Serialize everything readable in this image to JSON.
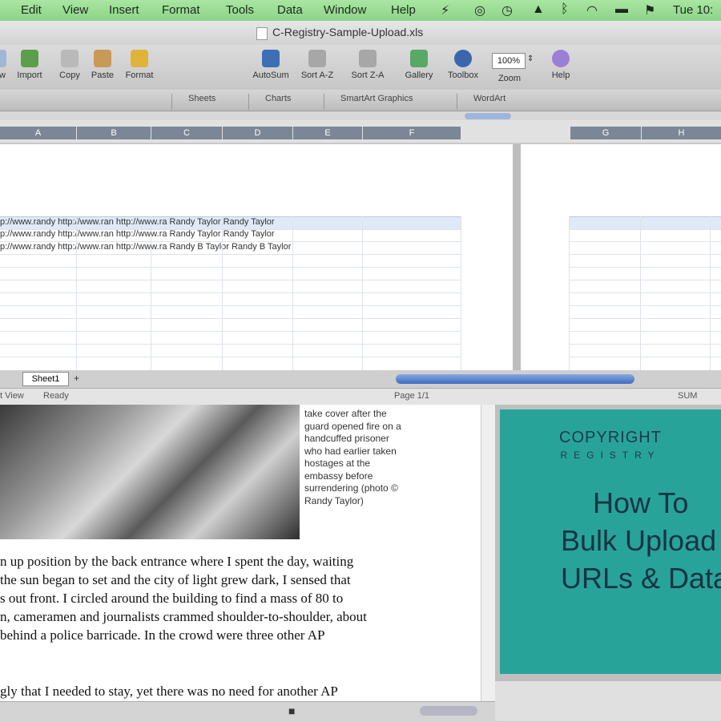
{
  "menubar": {
    "items": [
      "Edit",
      "View",
      "Insert",
      "Format",
      "Tools",
      "Data",
      "Window",
      "Help"
    ],
    "clock": "Tue 10:"
  },
  "window": {
    "title": "C-Registry-Sample-Upload.xls"
  },
  "toolbar": {
    "items": [
      "Import",
      "Copy",
      "Paste",
      "Format",
      "AutoSum",
      "Sort A-Z",
      "Sort Z-A",
      "Gallery",
      "Toolbox",
      "Zoom",
      "Help"
    ],
    "new_label": "w",
    "zoom_value": "100%"
  },
  "ribbon": {
    "tabs": [
      "Sheets",
      "Charts",
      "SmartArt Graphics",
      "WordArt"
    ]
  },
  "columns": {
    "left": [
      "A",
      "B",
      "C",
      "D",
      "E",
      "F"
    ],
    "right": [
      "G",
      "H"
    ]
  },
  "sheet": {
    "rows": [
      "p://www.randy http://www.ran http://www.ra Randy Taylor    Randy Taylor",
      "p://www.randy http://www.ran http://www.ra Randy Taylor    Randy Taylor",
      "p://www.randy http://www.ran http://www.ra Randy B Taylor  Randy B Taylor"
    ],
    "tab_name": "Sheet1"
  },
  "status": {
    "view": "t View",
    "mode": "Ready",
    "page": "Page 1/1",
    "zoom": "SUM"
  },
  "document": {
    "caption": "take cover after the guard opened fire on a handcuffed prisoner who had earlier taken hostages at the embassy before surrendering (photo © Randy Taylor)",
    "paragraphs": [
      "n up position by the back entrance where I spent the day, waiting",
      " the sun began to set and the city of light grew dark, I sensed that",
      "s out front. I circled around the building to find a mass of 80 to",
      "n, cameramen and journalists crammed shoulder-to-shoulder, about",
      "behind a police barricade. In the crowd were three other AP",
      "gly that I needed to stay, yet there was no need for another AP"
    ]
  },
  "promo": {
    "brand_line1": "COPYRIGHT",
    "brand_line2": "REGISTRY",
    "title": [
      "How To",
      "Bulk Upload",
      "URLs & Data"
    ]
  }
}
